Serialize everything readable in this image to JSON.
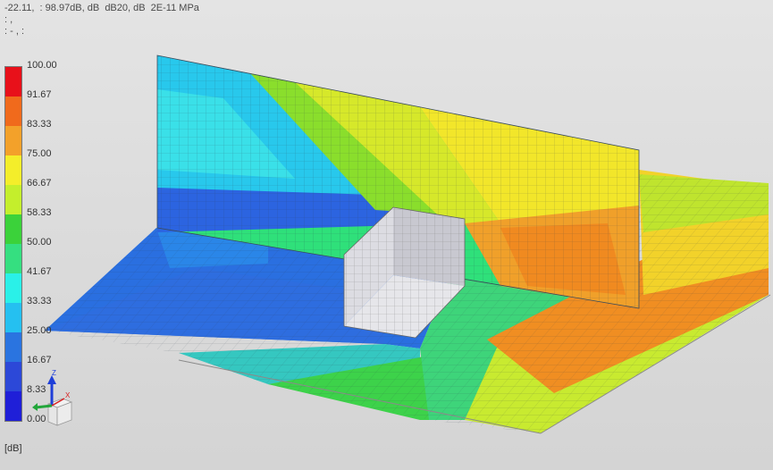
{
  "info_panel": {
    "line1": "-22.11,  : 98.97dB, dB  dB20, dB  2E-11 MPa",
    "line2": ": ,",
    "line3": ": - , :"
  },
  "legend": {
    "unit": "[dB]",
    "labels": [
      "100.00",
      "91.67",
      "83.33",
      "75.00",
      "66.67",
      "58.33",
      "50.00",
      "41.67",
      "33.33",
      "25.00",
      "16.67",
      "8.33",
      "0.00"
    ],
    "colors": [
      "#e8101a",
      "#f06a1c",
      "#f3a12a",
      "#f4ee2a",
      "#c4ef2c",
      "#3bd23a",
      "#35df80",
      "#2af0e8",
      "#25c0f0",
      "#2a74e0",
      "#2c48d8",
      "#1f1fd8"
    ]
  },
  "triad": {
    "z_label": "Z",
    "x_label": "X"
  }
}
